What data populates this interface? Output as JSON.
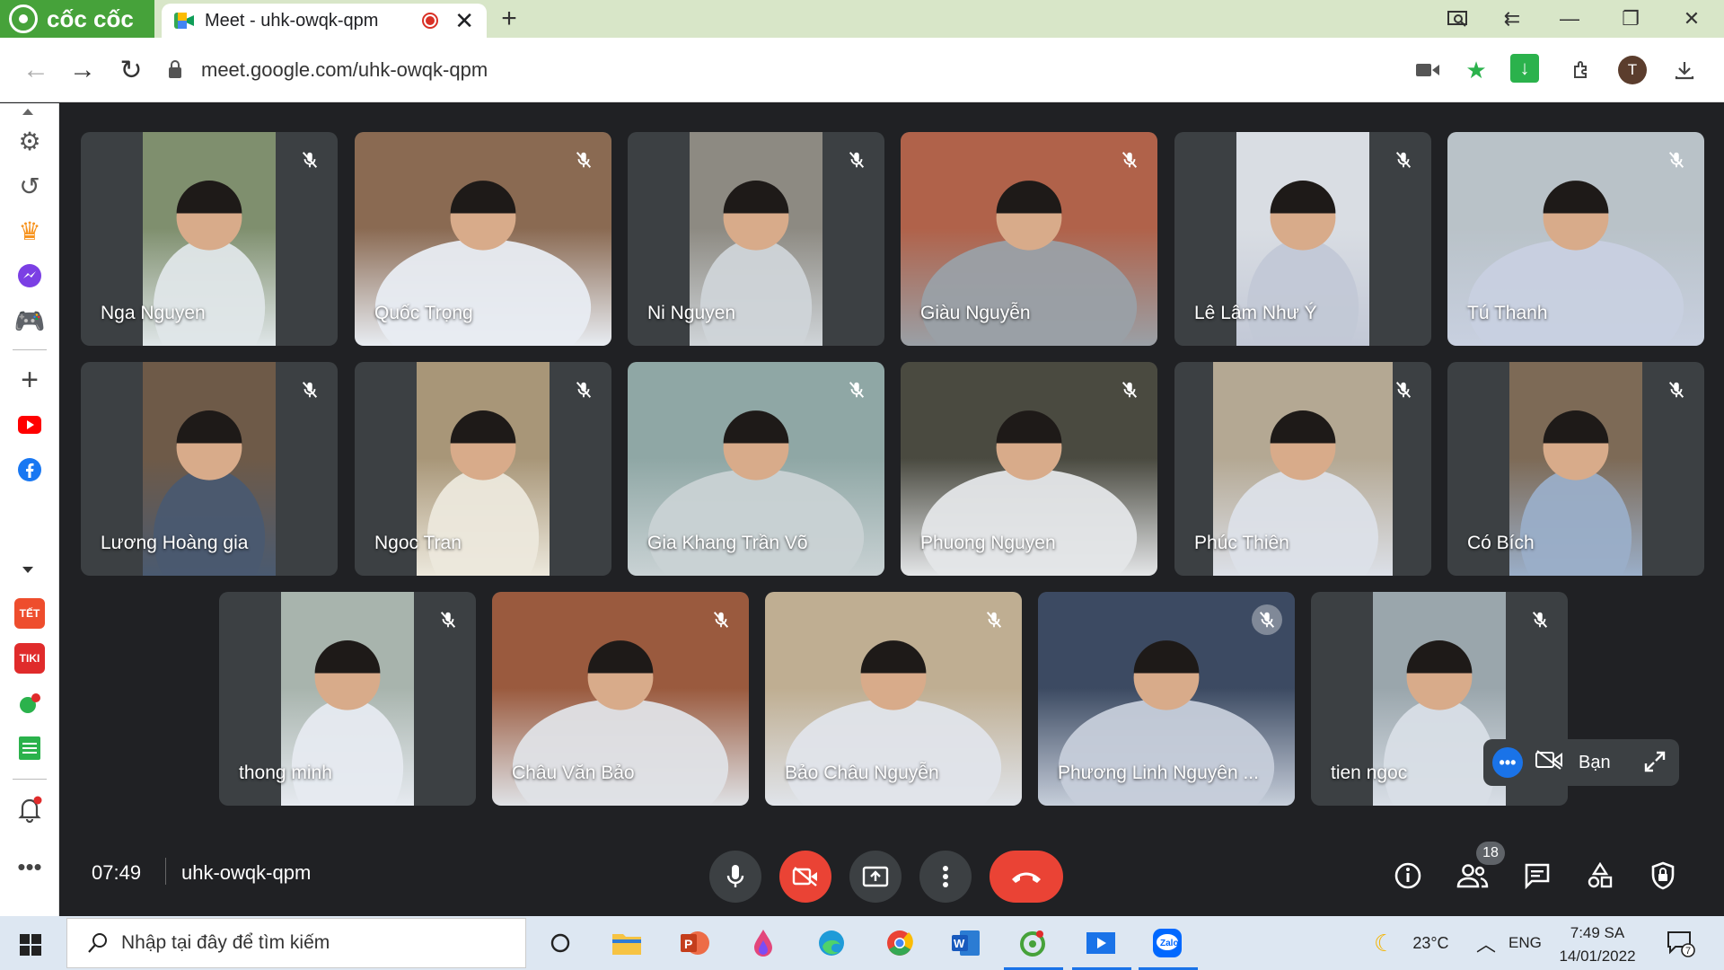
{
  "browser": {
    "brand": "cốc cốc",
    "tab_title": "Meet - uhk-owqk-qpm",
    "url": "meet.google.com/uhk-owqk-qpm"
  },
  "participants": [
    {
      "name": "Nga Nguyen",
      "bg": "#7f8f6e",
      "fg": "#dfe6e8"
    },
    {
      "name": "Quốc Trọng",
      "bg": "#8a6a52",
      "fg": "#e8ecf2"
    },
    {
      "name": "Ni Nguyen",
      "bg": "#8d8a82",
      "fg": "#cfd4d8"
    },
    {
      "name": "Giàu Nguyễn",
      "bg": "#b0624a",
      "fg": "#9aa0a6"
    },
    {
      "name": "Lê Lâm Như Ý",
      "bg": "#d9dde3",
      "fg": "#c2c8d6"
    },
    {
      "name": "Tú Thanh",
      "bg": "#b9c2c8",
      "fg": "#c8d0e0"
    },
    {
      "name": "Lương Hoàng gia",
      "bg": "#6e5a48",
      "fg": "#4a5a70"
    },
    {
      "name": "Ngoc Tran",
      "bg": "#a89678",
      "fg": "#ece8dc"
    },
    {
      "name": "Gia Khang Trần Võ",
      "bg": "#8fa7a5",
      "fg": "#c9d2d4"
    },
    {
      "name": "Phuong Nguyen",
      "bg": "#4a4a40",
      "fg": "#e4e6e8"
    },
    {
      "name": "Phúc Thiên",
      "bg": "#b4a893",
      "fg": "#dce0e8"
    },
    {
      "name": "Có Bích",
      "bg": "#7d6a56",
      "fg": "#9aaec8"
    },
    {
      "name": "thong minh",
      "bg": "#a8b4ad",
      "fg": "#e6eaf0"
    },
    {
      "name": "Châu Văn Bảo",
      "bg": "#9a5a3e",
      "fg": "#dfe2e6"
    },
    {
      "name": "Bảo Châu Nguyễn",
      "bg": "#bfae92",
      "fg": "#e0e4ea"
    },
    {
      "name": "Phương Linh Nguyên ...",
      "bg": "#3c4a62",
      "fg": "#c6ceda"
    },
    {
      "name": "tien ngoc",
      "bg": "#9aa6ac",
      "fg": "#d8dee6"
    }
  ],
  "self_view": {
    "label": "Bạn"
  },
  "meeting": {
    "time": "07:49",
    "code": "uhk-owqk-qpm",
    "participant_count": "18"
  },
  "taskbar": {
    "search_placeholder": "Nhập tại đây để tìm kiếm",
    "temperature": "23°C",
    "language": "ENG",
    "clock_time": "7:49 SA",
    "clock_date": "14/01/2022",
    "notification_count": "7"
  },
  "colors": {
    "meet_bg": "#202124",
    "tile_bg": "#3c4043",
    "danger": "#ea4335",
    "accent": "#1a73e8",
    "brand_green": "#46a23a"
  }
}
